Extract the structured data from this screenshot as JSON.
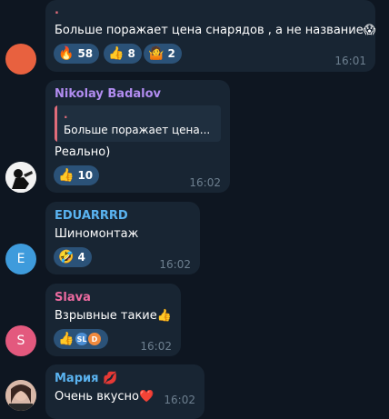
{
  "messages": [
    {
      "sender": ".",
      "sender_color": "#e06c7a",
      "text": "Больше поражает цена снарядов , а не название",
      "text_emoji": "😱",
      "avatar_color": "#e8613f",
      "reactions": [
        {
          "emoji": "🔥",
          "count": "58"
        },
        {
          "emoji": "👍",
          "count": "8"
        },
        {
          "emoji": "🤷",
          "count": "2"
        }
      ],
      "time": "16:01"
    },
    {
      "sender": "Nikolay Badalov",
      "sender_color": "#b18cf0",
      "reply": {
        "name": ".",
        "text": "Больше поражает цена..."
      },
      "text": "Реально)",
      "avatar_icon": "profile-photo",
      "reactions": [
        {
          "emoji": "👍",
          "count": "10"
        }
      ],
      "time": "16:02"
    },
    {
      "sender": "EDUARRRD",
      "sender_color": "#5ab3f0",
      "text": "Шиномонтаж",
      "avatar_letter": "E",
      "avatar_color": "#3e9bdc",
      "reactions": [
        {
          "emoji": "🤣",
          "count": "4"
        }
      ],
      "time": "16:02"
    },
    {
      "sender": "Slava",
      "sender_color": "#ec6aa0",
      "text": "Взрывные такие",
      "text_emoji": "👍",
      "avatar_letter": "S",
      "avatar_color": "#e3597e",
      "reactions": [
        {
          "emoji": "👍",
          "reactors": [
            "SL",
            "D"
          ]
        }
      ],
      "time": "16:02"
    },
    {
      "sender": "Мария",
      "sender_emoji": "💋",
      "sender_color": "#5ab3f0",
      "text": "Очень вкусно",
      "text_emoji": "❤️",
      "avatar_icon": "profile-photo",
      "time": "16:02"
    }
  ]
}
